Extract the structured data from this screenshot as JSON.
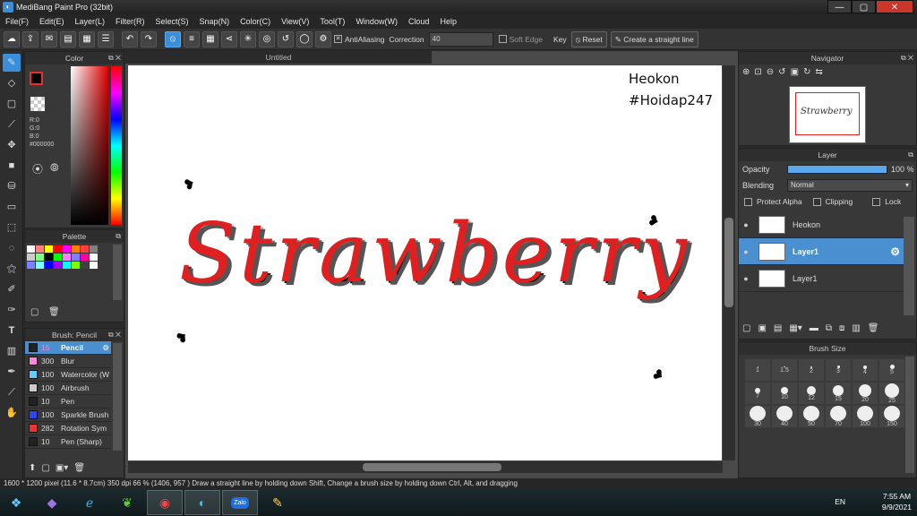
{
  "window": {
    "title": "MediBang Paint Pro (32bit)",
    "minimize": "—",
    "maximize": "▢",
    "close": "✕"
  },
  "menu": [
    "File(F)",
    "Edit(E)",
    "Layer(L)",
    "Filter(R)",
    "Select(S)",
    "Snap(N)",
    "Color(C)",
    "View(V)",
    "Tool(T)",
    "Window(W)",
    "Cloud",
    "Help"
  ],
  "toolbar": {
    "antialiasing": "AntiAliasing",
    "correction_label": "Correction",
    "correction_value": "40",
    "soft_edge": "Soft Edge",
    "key_label": "Key",
    "reset": "Reset",
    "straight_line": "Create a straight line"
  },
  "color_panel": {
    "title": "Color",
    "r": "R:0",
    "g": "G:0",
    "b": "B:0",
    "hex": "#000000"
  },
  "palette_panel": {
    "title": "Palette"
  },
  "brush_panel": {
    "title": "Brush: Pencil",
    "items": [
      {
        "size": "15",
        "name": "Pencil",
        "color": "#222222"
      },
      {
        "size": "300",
        "name": "Blur",
        "color": "#ff88dd"
      },
      {
        "size": "100",
        "name": "Watercolor (W",
        "color": "#66ccff"
      },
      {
        "size": "100",
        "name": "Airbrush",
        "color": "#cccccc"
      },
      {
        "size": "10",
        "name": "Pen",
        "color": "#222222"
      },
      {
        "size": "100",
        "name": "Sparkle Brush",
        "color": "#3344ee"
      },
      {
        "size": "282",
        "name": "Rotation Sym",
        "color": "#ee3333"
      },
      {
        "size": "10",
        "name": "Pen (Sharp)",
        "color": "#222222"
      }
    ]
  },
  "document": {
    "tab": "Untitled",
    "watermark_1": "Heokon",
    "watermark_2": "#Hoidap247",
    "artwork_text": "Strawberry"
  },
  "navigator": {
    "title": "Navigator",
    "thumb_text": "Strawberry"
  },
  "layer_panel": {
    "title": "Layer",
    "opacity_label": "Opacity",
    "opacity_value": "100 %",
    "opacity_fraction": 1.0,
    "blending_label": "Blending",
    "blending_value": "Normal",
    "protect_alpha": "Protect Alpha",
    "clipping": "Clipping",
    "lock": "Lock",
    "layers": [
      "Heokon",
      "Layer1",
      "Layer1"
    ]
  },
  "brush_size_panel": {
    "title": "Brush Size",
    "sizes": [
      "1",
      "1.5",
      "2",
      "3",
      "4",
      "5",
      "7",
      "10",
      "12",
      "15",
      "20",
      "25",
      "30",
      "40",
      "50",
      "70",
      "100",
      "150"
    ]
  },
  "status": {
    "text": "1600 * 1200 pixel  (11.6 * 8.7cm)  350 dpi  66 %  (1406, 957 )  Draw a straight line by holding down Shift, Change a brush size by holding down Ctrl, Alt, and dragging"
  },
  "taskbar": {
    "lang": "EN",
    "time": "7:55 AM",
    "date": "9/9/2021",
    "zalo": "Zalo"
  },
  "colors": {
    "accent": "#3a8fd8",
    "selected_row": "#4a90d0",
    "text_red": "#e02020"
  }
}
